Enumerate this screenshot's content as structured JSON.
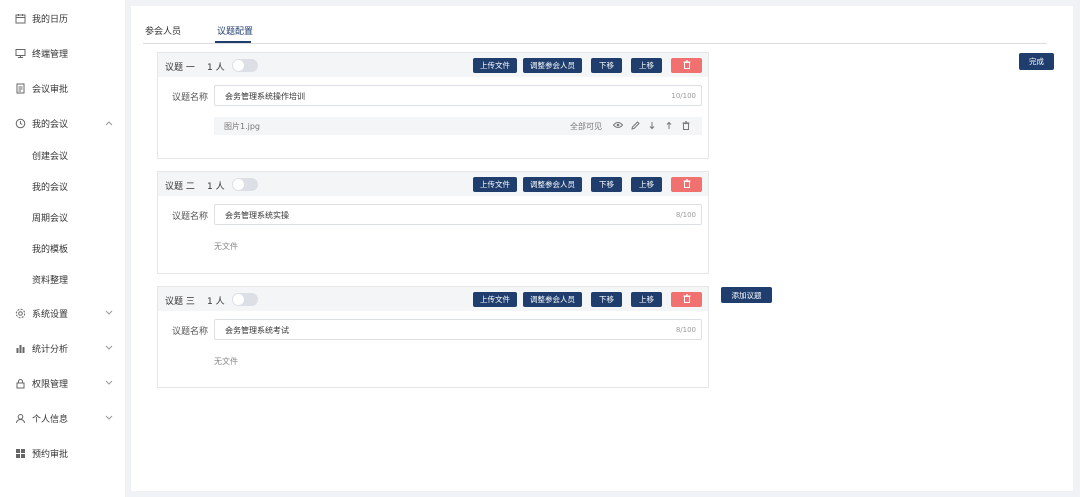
{
  "sidebar": {
    "items": [
      {
        "label": "我的日历",
        "icon": "calendar-icon"
      },
      {
        "label": "终端管理",
        "icon": "monitor-icon"
      },
      {
        "label": "会议审批",
        "icon": "document-icon"
      },
      {
        "label": "我的会议",
        "icon": "clock-icon"
      },
      {
        "label": "系统设置",
        "icon": "gear-icon"
      },
      {
        "label": "统计分析",
        "icon": "bar-chart-icon"
      },
      {
        "label": "权限管理",
        "icon": "lock-icon"
      },
      {
        "label": "个人信息",
        "icon": "user-icon"
      },
      {
        "label": "预约审批",
        "icon": "grid-icon"
      }
    ],
    "submenu": [
      "创建会议",
      "我的会议",
      "周期会议",
      "我的模板",
      "资料整理"
    ]
  },
  "tabs": [
    {
      "label": "参会人员",
      "active": false
    },
    {
      "label": "议题配置",
      "active": true
    }
  ],
  "buttons": {
    "upload": "上传文件",
    "adjust": "调整参会人员",
    "down": "下移",
    "up": "上移",
    "delete": "🗑",
    "add_topic": "添加议题",
    "done": "完成"
  },
  "topic_name_label": "议题名称",
  "topics": [
    {
      "title": "议题 一",
      "count": "1 人",
      "name": "会务管理系统操作培训",
      "char_count": "10/100",
      "files": [
        {
          "name": "图片1.jpg",
          "permission": "全部可见"
        }
      ],
      "no_file_text": ""
    },
    {
      "title": "议题 二",
      "count": "1 人",
      "name": "会务管理系统实操",
      "char_count": "8/100",
      "files": [],
      "no_file_text": "无文件"
    },
    {
      "title": "议题 三",
      "count": "1 人",
      "name": "会务管理系统考试",
      "char_count": "8/100",
      "files": [],
      "no_file_text": "无文件"
    }
  ],
  "colors": {
    "primary": "#1f3e6e",
    "danger": "#f07170",
    "background": "#f0f2f5"
  }
}
